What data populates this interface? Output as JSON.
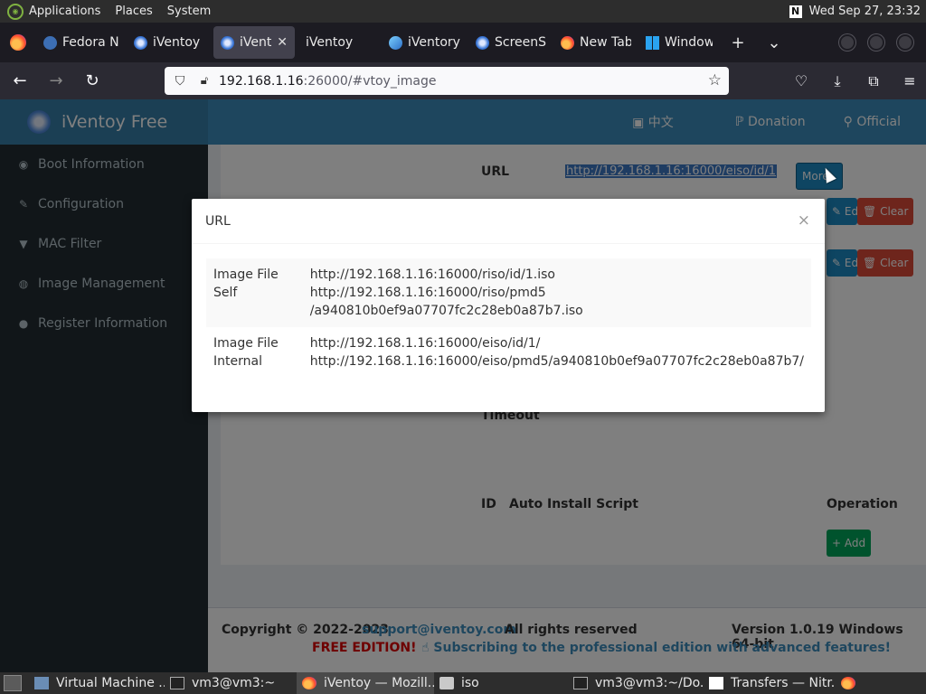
{
  "top_panel": {
    "menus": [
      "Applications",
      "Places",
      "System"
    ],
    "clock": "Wed Sep 27, 23:32",
    "tray_icon": "N"
  },
  "browser": {
    "tabs": [
      {
        "label": "Fedora N",
        "icon": "fedora-icon",
        "active": false
      },
      {
        "label": "iVentoy",
        "icon": "iventoy-icon",
        "active": false
      },
      {
        "label": "iVento",
        "icon": "iventoy-icon",
        "active": true
      },
      {
        "label": "iVentoy",
        "icon": "none",
        "active": false
      },
      {
        "label": "iVentory",
        "icon": "blue-icon",
        "active": false
      },
      {
        "label": "ScreenSh",
        "icon": "iventoy-icon",
        "active": false
      },
      {
        "label": "New Tab",
        "icon": "firefox-icon",
        "active": false
      },
      {
        "label": "Window",
        "icon": "windows-icon",
        "active": false
      }
    ],
    "new_tab_label": "+",
    "tab_list_label": "⌄",
    "url_host": "192.168.1.16",
    "url_rest": ":26000/#vtoy_image"
  },
  "page": {
    "brand": "iVentoy Free",
    "header_links": {
      "lang": "中文",
      "donation": "Donation",
      "official": "Official"
    },
    "sidebar": [
      {
        "label": "Boot Information",
        "icon": "◉"
      },
      {
        "label": "Configuration",
        "icon": "✎"
      },
      {
        "label": "MAC Filter",
        "icon": "▼"
      },
      {
        "label": "Image Management",
        "icon": "◍"
      },
      {
        "label": "Register Information",
        "icon": "●"
      }
    ],
    "url_label": "URL",
    "url_value": "http://192.168.1.16:16000/eiso/id/1",
    "more_button": "More",
    "edit_button": "Edit",
    "clear_button": "Clear",
    "timeout_label": "Timeout",
    "table_headers": {
      "id": "ID",
      "script": "Auto Install Script",
      "operation": "Operation"
    },
    "add_button": "Add",
    "footer": {
      "copyright": "Copyright © 2022-2023",
      "email": "support@iventoy.com",
      "rights": "All rights reserved",
      "version": "Version 1.0.19 Windows 64-bit",
      "free": "FREE EDITION!",
      "subscribe": "Subscribing to the professional edition with advanced features!"
    }
  },
  "modal": {
    "title": "URL",
    "close": "×",
    "rows": [
      {
        "key": "Image File Self",
        "lines": [
          "http://192.168.1.16:16000/riso/id/1.iso",
          "http://192.168.1.16:16000/riso/pmd5",
          "/a940810b0ef9a07707fc2c28eb0a87b7.iso"
        ]
      },
      {
        "key": "Image File Internal",
        "lines": [
          "http://192.168.1.16:16000/eiso/id/1/",
          "http://192.168.1.16:16000/eiso/pmd5/a940810b0ef9a07707fc2c28eb0a87b7/"
        ]
      }
    ]
  },
  "taskbar": [
    {
      "label": "Virtual Machine ...",
      "icon": "vm-icon",
      "active": false
    },
    {
      "label": "vm3@vm3:~",
      "icon": "terminal-icon",
      "active": false
    },
    {
      "label": "iVentoy — Mozill...",
      "icon": "firefox-icon",
      "active": true
    },
    {
      "label": "iso",
      "icon": "folder-icon",
      "active": false
    },
    {
      "label": "vm3@vm3:~/Do...",
      "icon": "terminal-icon",
      "active": false
    },
    {
      "label": "Transfers — Nitr...",
      "icon": "n-icon",
      "active": false
    }
  ]
}
